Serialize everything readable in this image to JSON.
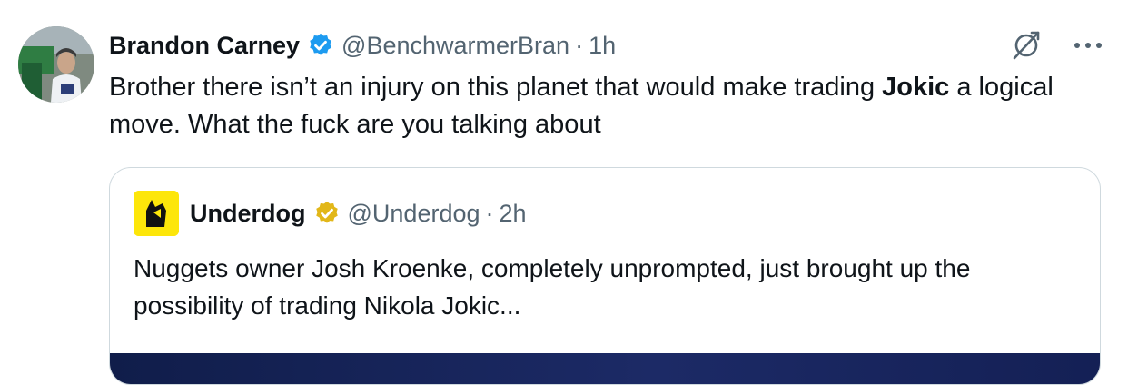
{
  "tweet": {
    "author": {
      "name": "Brandon Carney",
      "handle": "@BenchwarmerBran",
      "verified_color": "#1d9bf0"
    },
    "separator": "·",
    "time": "1h",
    "text_before": "Brother there isn’t an injury on this planet that would make trading ",
    "text_bold": "Jokic",
    "text_after": " a logical move. What the fuck are you talking about",
    "actions": {
      "grok_icon": "grok-icon",
      "more_icon": "more-dots-icon"
    }
  },
  "quoted": {
    "author": {
      "name": "Underdog",
      "handle": "@Underdog",
      "verified_color": "#e2b719"
    },
    "separator": "·",
    "time": "2h",
    "text": "Nuggets owner Josh Kroenke, completely unprompted, just brought up the possibility of trading Nikola Jokic..."
  }
}
